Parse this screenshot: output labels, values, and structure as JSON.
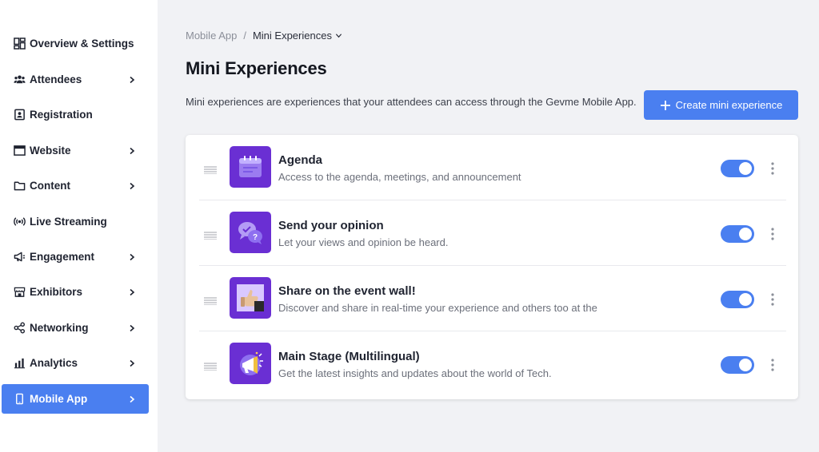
{
  "sidebar": {
    "items": [
      {
        "label": "Overview & Settings",
        "icon": "dashboard-icon",
        "chevron": false,
        "active": false
      },
      {
        "label": "Attendees",
        "icon": "people-icon",
        "chevron": true,
        "active": false
      },
      {
        "label": "Registration",
        "icon": "badge-icon",
        "chevron": false,
        "active": false
      },
      {
        "label": "Website",
        "icon": "browser-icon",
        "chevron": true,
        "active": false
      },
      {
        "label": "Content",
        "icon": "folder-icon",
        "chevron": true,
        "active": false
      },
      {
        "label": "Live Streaming",
        "icon": "broadcast-icon",
        "chevron": false,
        "active": false
      },
      {
        "label": "Engagement",
        "icon": "megaphone-icon",
        "chevron": true,
        "active": false
      },
      {
        "label": "Exhibitors",
        "icon": "store-icon",
        "chevron": true,
        "active": false
      },
      {
        "label": "Networking",
        "icon": "share-nodes-icon",
        "chevron": true,
        "active": false
      },
      {
        "label": "Analytics",
        "icon": "bar-chart-icon",
        "chevron": true,
        "active": false
      },
      {
        "label": "Mobile App",
        "icon": "mobile-icon",
        "chevron": true,
        "active": true
      }
    ]
  },
  "breadcrumb": {
    "root": "Mobile App",
    "separator": "/",
    "current": "Mini Experiences"
  },
  "page": {
    "title": "Mini Experiences",
    "description": "Mini experiences are experiences that your attendees can access through the Gevme Mobile App."
  },
  "create_button": {
    "label": "Create mini experience",
    "icon": "plus-icon"
  },
  "experiences": [
    {
      "title": "Agenda",
      "description": "Access to the agenda, meetings, and announcement",
      "enabled": true,
      "icon": "calendar-icon"
    },
    {
      "title": "Send your opinion",
      "description": "Let your views and opinion be heard.",
      "enabled": true,
      "icon": "chat-bubbles-icon"
    },
    {
      "title": "Share on the event wall!",
      "description": "Discover and share in real-time your experience and others too at the",
      "enabled": true,
      "icon": "thumbs-up-icon"
    },
    {
      "title": "Main Stage (Multilingual)",
      "description": "Get the latest insights and updates about the world of Tech.",
      "enabled": true,
      "icon": "megaphone-icon"
    }
  ],
  "colors": {
    "accent": "#4a7ff0",
    "thumb_bg": "#6a2fd3",
    "page_bg": "#f1f2f5"
  }
}
